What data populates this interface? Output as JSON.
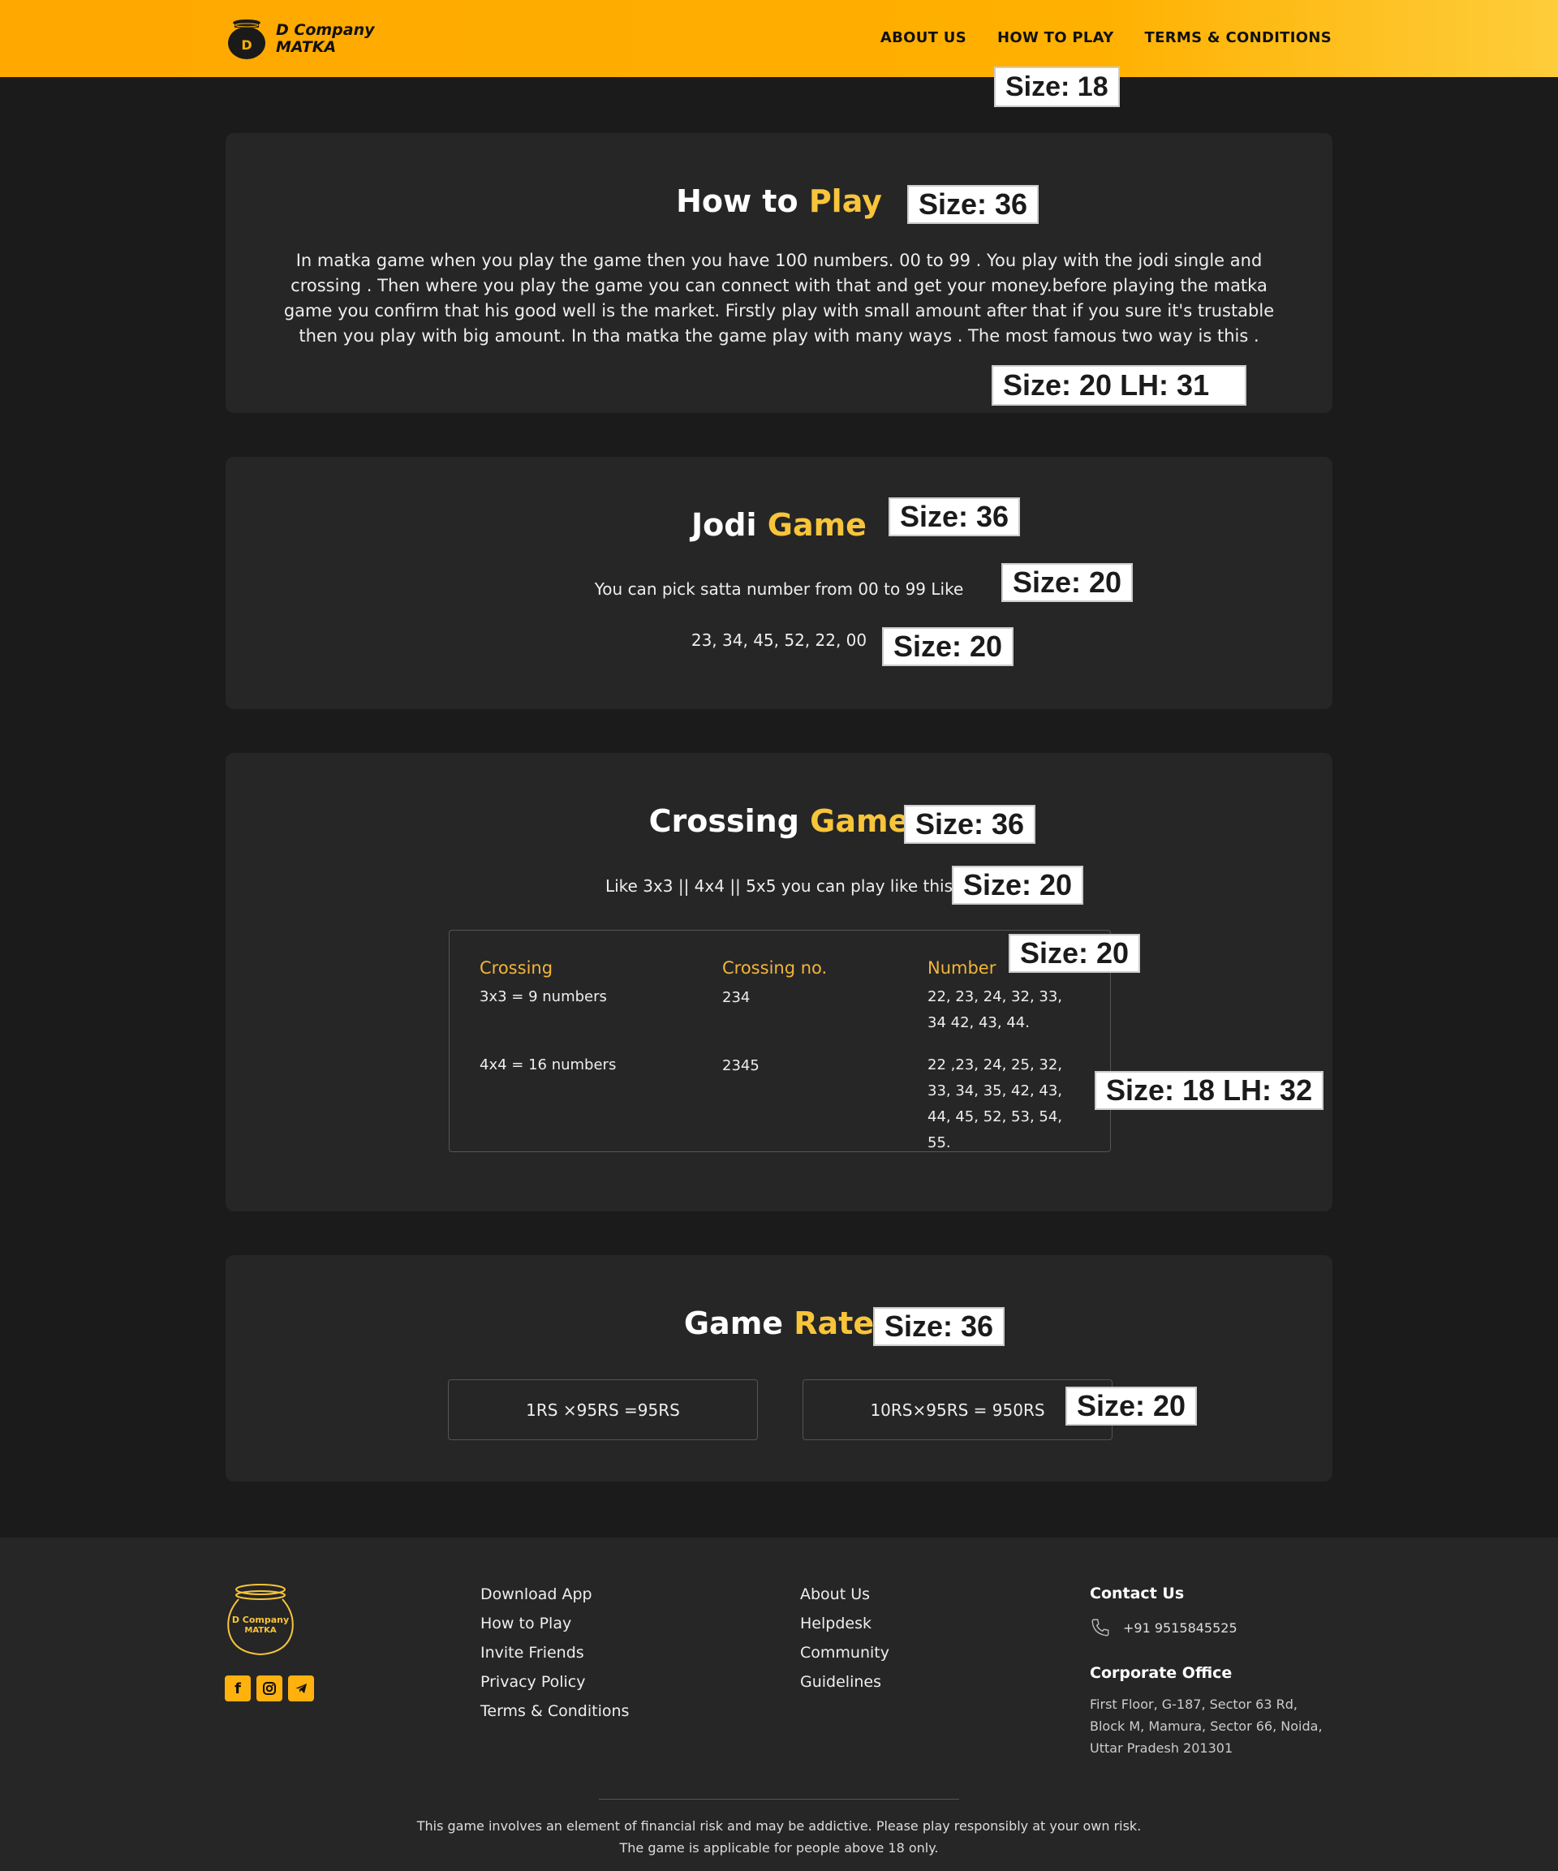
{
  "header": {
    "logo_line1": "D Company",
    "logo_line2": "MATKA",
    "logo_letter": "D",
    "nav": [
      "ABOUT US",
      "HOW TO PLAY",
      "TERMS & CONDITIONS"
    ]
  },
  "annotations": {
    "nav": "Size: 18",
    "how_title": "Size: 36",
    "how_para": "Size: 20 LH: 31",
    "jodi_title": "Size: 36",
    "jodi_line1": "Size: 20",
    "jodi_line2": "Size: 20",
    "cross_title": "Size: 36",
    "cross_line": "Size: 20",
    "cross_header": "Size: 20",
    "cross_cell": "Size: 18 LH: 32",
    "rate_title": "Size: 36",
    "rate_box": "Size: 20"
  },
  "how_to_play": {
    "title_main": "How to",
    "title_accent": "Play",
    "paragraph": "In matka game when you play the game then you have 100 numbers. 00 to 99 . You play with the jodi single and crossing . Then where you play the game you can connect with that and get your money.before playing the matka game you confirm that his good well is the market. Firstly play with small amount after that if you sure it's trustable then you play with big amount. In tha matka the game play with many ways . The most famous two way is this ."
  },
  "jodi_game": {
    "title_main": "Jodi",
    "title_accent": "Game",
    "line1": "You can pick satta number from 00 to 99 Like",
    "line2": "23, 34, 45, 52, 22, 00"
  },
  "crossing_game": {
    "title_main": "Crossing",
    "title_accent": "Game",
    "line": "Like 3x3 || 4x4 || 5x5 you can play like this",
    "headers": [
      "Crossing",
      "Crossing no.",
      "Number"
    ],
    "rows": [
      {
        "crossing": "3x3 = 9 numbers",
        "no": "234",
        "number": "22, 23, 24, 32, 33, 34 42, 43, 44."
      },
      {
        "crossing": "4x4 = 16 numbers",
        "no": "2345",
        "number": "22 ,23, 24, 25, 32, 33, 34, 35, 42, 43, 44, 45, 52, 53, 54, 55."
      }
    ]
  },
  "game_rate": {
    "title_main": "Game",
    "title_accent": "Rate",
    "rates": [
      "1RS ×95RS =95RS",
      "10RS×95RS = 950RS"
    ]
  },
  "footer": {
    "logo_line1": "D Company",
    "logo_line2": "MATKA",
    "col1": [
      "Download App",
      "How to Play",
      "Invite Friends",
      "Privacy Policy",
      "Terms & Conditions"
    ],
    "col2": [
      "About Us",
      "Helpdesk",
      "Community",
      "Guidelines"
    ],
    "contact_title": "Contact Us",
    "phone": "+91 9515845525",
    "office_title": "Corporate Office",
    "address_line1": "First Floor, G-187, Sector 63 Rd,",
    "address_line2": "Block M, Mamura, Sector 66, Noida,",
    "address_line3": "Uttar Pradesh 201301",
    "disclaimer1": "This game involves an element of financial risk and may be addictive. Please play responsibly at your own risk.",
    "disclaimer2": "The game is applicable for people above 18 only."
  },
  "colors": {
    "header_bg": "#ffa800",
    "accent": "#f8c53a",
    "page_bg": "#1b1b1b",
    "card_bg": "#262626"
  },
  "icons": [
    "facebook-icon",
    "instagram-icon",
    "telegram-icon",
    "phone-icon",
    "matka-pot-icon"
  ]
}
